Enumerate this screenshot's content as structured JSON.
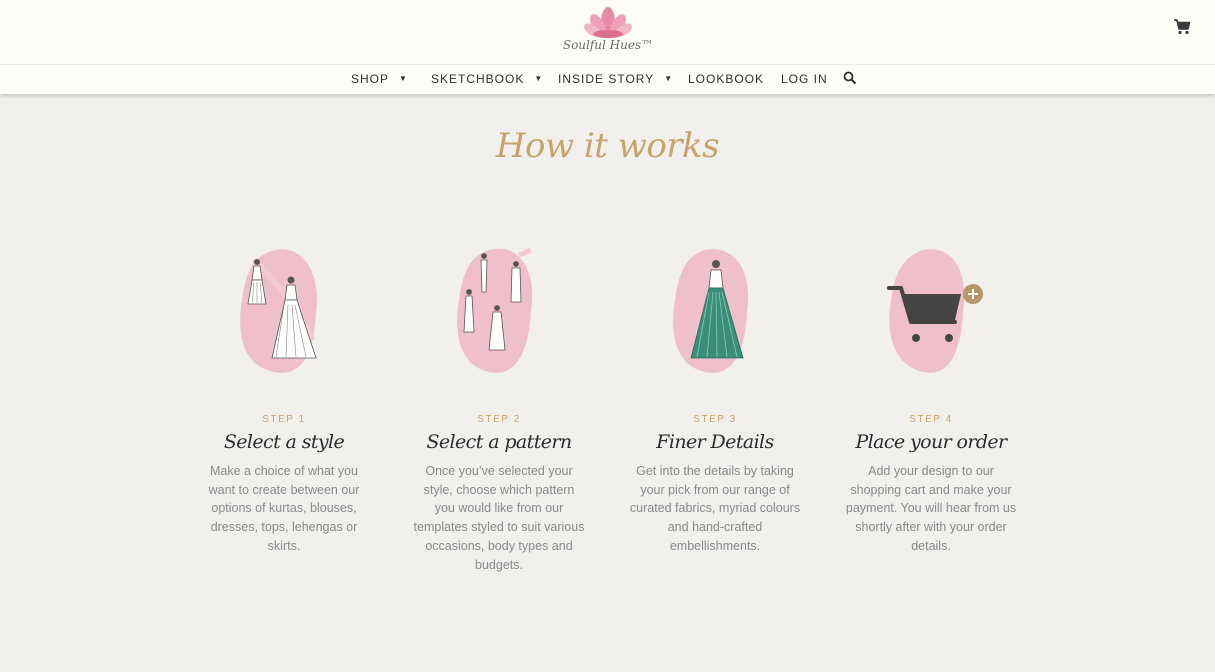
{
  "brand": {
    "name": "Soulful Hues",
    "logo_text": "Soulful Hues™"
  },
  "colors": {
    "accent": "#c7a46a",
    "pink_wash": "#eeb7c4",
    "teal": "#3b8f78",
    "cart": "#444444"
  },
  "header": {
    "cart_icon": "cart-icon"
  },
  "nav": {
    "items": [
      {
        "label": "SHOP",
        "has_dropdown": true
      },
      {
        "label": "SKETCHBOOK",
        "has_dropdown": true
      },
      {
        "label": "INSIDE STORY",
        "has_dropdown": true
      },
      {
        "label": "LOOKBOOK",
        "has_dropdown": false
      },
      {
        "label": "LOG IN",
        "has_dropdown": false
      }
    ],
    "dropdown_glyph": "▼",
    "search_icon": "search-icon"
  },
  "main": {
    "title": "How it works",
    "steps": [
      {
        "number": "STEP 1",
        "title": "Select a style",
        "description": "Make a choice of what you want to create between our options of kurtas, blouses, dresses, tops, lehengas or skirts.",
        "illustration": "two-outfits-sketch"
      },
      {
        "number": "STEP 2",
        "title": "Select a pattern",
        "description": "Once you’ve selected your style, choose which pattern you would like from our templates styled to suit various occasions, body types and budgets.",
        "illustration": "pattern-templates-sketch"
      },
      {
        "number": "STEP 3",
        "title": "Finer Details",
        "description": "Get into the details by taking your pick from our range of curated fabrics, myriad colours and hand-crafted embellishments.",
        "illustration": "green-lehenga-sketch"
      },
      {
        "number": "STEP 4",
        "title": "Place your order",
        "description": "Add your design to our shopping cart and make your payment. You will hear from us shortly after with your order details.",
        "illustration": "shopping-cart-plus"
      }
    ]
  }
}
